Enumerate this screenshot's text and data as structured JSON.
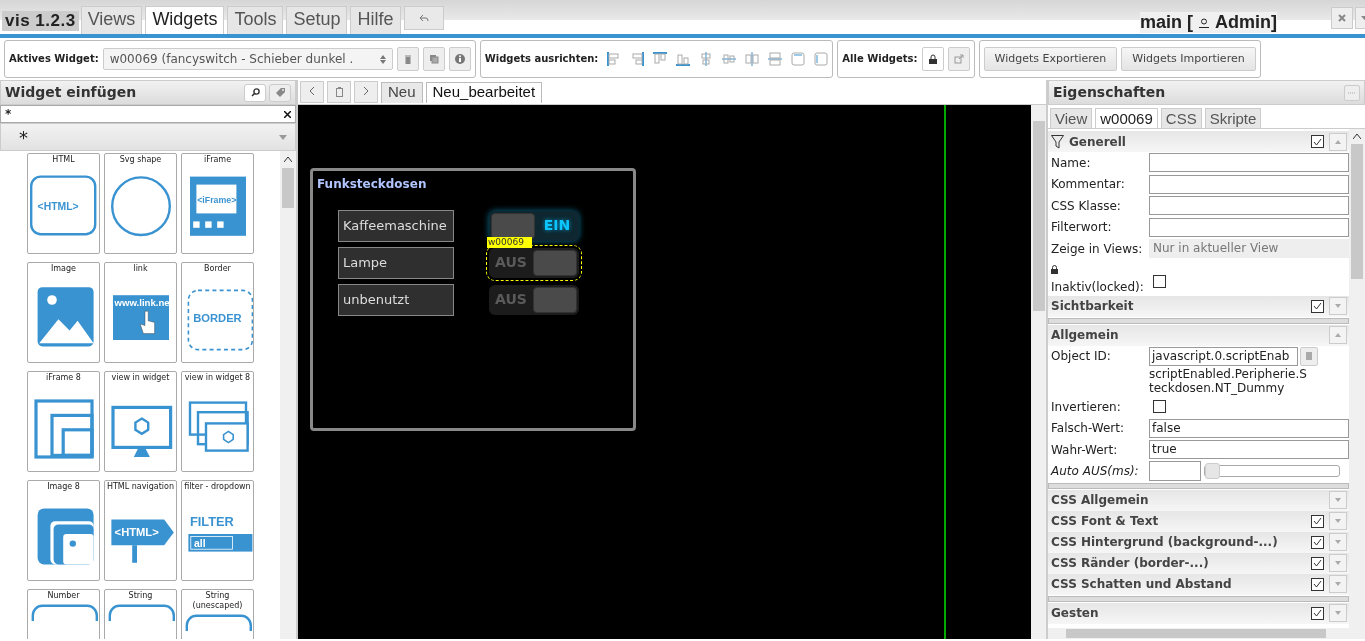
{
  "app": {
    "title": "vis 1.2.3"
  },
  "main_tabs": [
    {
      "label": "Views",
      "selected": false
    },
    {
      "label": "Widgets",
      "selected": true
    },
    {
      "label": "Tools",
      "selected": false
    },
    {
      "label": "Setup",
      "selected": false
    },
    {
      "label": "Hilfe",
      "selected": false
    }
  ],
  "user": {
    "prefix": "main [",
    "name": "Admin]"
  },
  "toolbar": {
    "active_label": "Aktives Widget:",
    "active_widget": "w00069 (fancyswitch - Schieber dunkel .",
    "align_label": "Widgets ausrichten:",
    "all_label": "Alle Widgets:",
    "buttons": [
      "Widgets Exportieren",
      "Widgets Importieren"
    ]
  },
  "palette": {
    "title": "Widget einfügen",
    "filter": "*",
    "set": "*",
    "items": [
      {
        "label": "HTML",
        "kind": "html",
        "icon_texts": [
          "<HTML>"
        ]
      },
      {
        "label": "Svg shape",
        "kind": "svg"
      },
      {
        "label": "iFrame",
        "kind": "iframe",
        "icon_texts": [
          "<iFrame>"
        ]
      },
      {
        "label": "Image",
        "kind": "image"
      },
      {
        "label": "link",
        "kind": "link",
        "icon_texts": [
          "www.link.ne"
        ]
      },
      {
        "label": "Border",
        "kind": "border",
        "icon_texts": [
          "BORDER"
        ]
      },
      {
        "label": "iFrame 8",
        "kind": "iframe8"
      },
      {
        "label": "view in widget",
        "kind": "view"
      },
      {
        "label": "view in widget 8",
        "kind": "view8"
      },
      {
        "label": "Image 8",
        "kind": "image8"
      },
      {
        "label": "HTML navigation",
        "kind": "nav",
        "icon_texts": [
          "<HTML>"
        ]
      },
      {
        "label": "filter - dropdown",
        "kind": "filter",
        "icon_texts": [
          "FILTER",
          "all"
        ]
      },
      {
        "label": "Number",
        "kind": "value"
      },
      {
        "label": "String",
        "kind": "value"
      },
      {
        "label": "String (unescaped)",
        "kind": "value"
      }
    ]
  },
  "editor": {
    "view_tabs": [
      {
        "label": "Neu",
        "selected": false
      },
      {
        "label": "Neu_bearbeitet",
        "selected": true
      }
    ],
    "group": {
      "title": "Funksteckdosen",
      "rows": [
        {
          "label": "Kaffeemaschine",
          "on": true,
          "switch_text": "EIN",
          "selected": false
        },
        {
          "label": "Lampe",
          "on": false,
          "switch_text": "AUS",
          "selected": true,
          "tag": "w00069"
        },
        {
          "label": "unbenutzt",
          "on": false,
          "switch_text": "AUS",
          "selected": false
        }
      ]
    }
  },
  "properties": {
    "title": "Eigenschaften",
    "tabs": [
      {
        "label": "View",
        "selected": false
      },
      {
        "label": "w00069",
        "selected": true
      },
      {
        "label": "CSS",
        "selected": false
      },
      {
        "label": "Skripte",
        "selected": false
      }
    ],
    "sections": [
      {
        "title": "Generell",
        "filter": true,
        "checked": true,
        "expanded": true,
        "group_start": false,
        "fields": [
          {
            "kind": "text",
            "label": "Name:"
          },
          {
            "kind": "text",
            "label": "Kommentar:"
          },
          {
            "kind": "text",
            "label": "CSS Klasse:"
          },
          {
            "kind": "text",
            "label": "Filterwort:"
          },
          {
            "kind": "select",
            "label": "Zeige in Views:",
            "value": "Nur in aktueller View"
          },
          {
            "kind": "checkbox",
            "label": "Inaktiv(locked):",
            "locked": true,
            "checked": false
          }
        ]
      },
      {
        "title": "Sichtbarkeit",
        "filter": false,
        "checked": true,
        "expanded": false,
        "group_start": false
      },
      {
        "title": "Allgemein",
        "filter": false,
        "expanded": true,
        "group_start": true,
        "fields": [
          {
            "kind": "objectid",
            "label": "Object ID:",
            "value": "javascript.0.scriptEnab",
            "note": "scriptEnabled.Peripherie.Steckdosen.NT_Dummy"
          },
          {
            "kind": "checkbox",
            "label": "Invertieren:",
            "checked": false
          },
          {
            "kind": "text",
            "label": "Falsch-Wert:",
            "value": "false"
          },
          {
            "kind": "text",
            "label": "Wahr-Wert:",
            "value": "true"
          },
          {
            "kind": "slider",
            "label": "Auto AUS(ms):",
            "italic": true,
            "level": 0
          }
        ]
      },
      {
        "title": "CSS Allgemein",
        "filter": false,
        "expanded": false,
        "group_start": true
      },
      {
        "title": "CSS Font & Text",
        "filter": false,
        "checked": true,
        "expanded": false,
        "group_start": false
      },
      {
        "title": "CSS Hintergrund (background-...)",
        "filter": false,
        "checked": true,
        "expanded": false,
        "group_start": false
      },
      {
        "title": "CSS Ränder (border-...)",
        "filter": false,
        "checked": true,
        "expanded": false,
        "group_start": false
      },
      {
        "title": "CSS Schatten und Abstand",
        "filter": false,
        "checked": true,
        "expanded": false,
        "group_start": false
      },
      {
        "title": "Gesten",
        "filter": false,
        "checked": true,
        "expanded": false,
        "group_start": true
      }
    ]
  }
}
